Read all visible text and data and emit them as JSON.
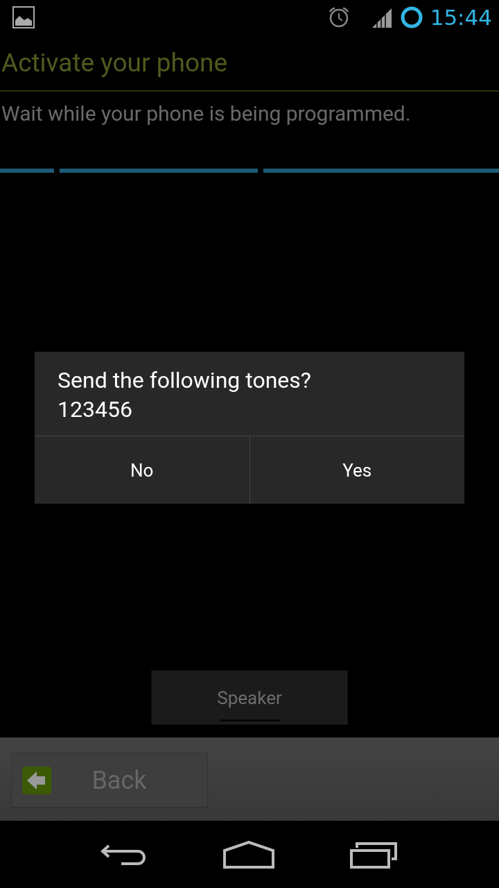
{
  "status_bar": {
    "time": "15:44"
  },
  "title": "Activate your phone",
  "message": "Wait while your phone is being programmed.",
  "progress": {
    "indeterminate": true
  },
  "dialog": {
    "message": "Send the following tones?\n123456",
    "buttons": [
      "No",
      "Yes"
    ]
  },
  "speaker_button": {
    "label": "Speaker",
    "on": false
  },
  "back_button": {
    "label": "Back",
    "disabled": true
  }
}
